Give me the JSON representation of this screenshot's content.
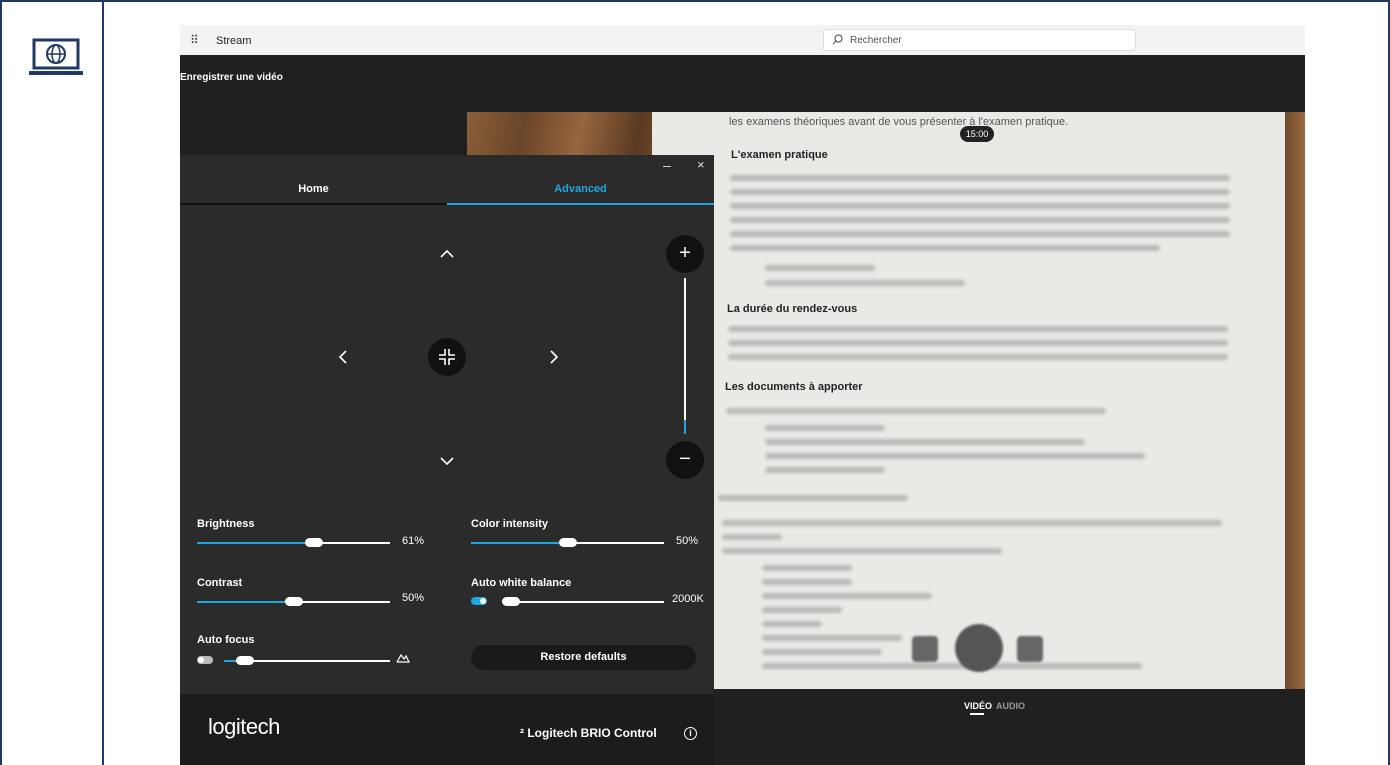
{
  "stream": {
    "app_name": "Stream",
    "search_placeholder": "Rechercher",
    "page_title": "Enregistrer une vidéo"
  },
  "preview": {
    "visible_text": "les examens théoriques avant de vous présenter à l'examen pratique.",
    "headings": [
      "L'examen pratique",
      "La durée du rendez-vous",
      "Les documents à apporter"
    ],
    "timer": "15:00",
    "modes": {
      "video": "VIDÉO",
      "audio": "AUDIO"
    }
  },
  "panel": {
    "window": {
      "minimize": "–",
      "close": "×"
    },
    "tabs": {
      "home": "Home",
      "advanced": "Advanced",
      "active": "Advanced"
    },
    "zoom": {
      "plus": "+",
      "minus": "−",
      "level": 0.09
    },
    "sliders": {
      "brightness": {
        "label": "Brightness",
        "value": "61%",
        "fraction": 0.61
      },
      "color_intensity": {
        "label": "Color intensity",
        "value": "50%",
        "fraction": 0.5
      },
      "contrast": {
        "label": "Contrast",
        "value": "50%",
        "fraction": 0.5
      },
      "auto_white_balance": {
        "label": "Auto white balance",
        "value": "2000K",
        "fraction": 0.0,
        "toggle_on": true
      },
      "auto_focus": {
        "label": "Auto focus",
        "fraction": 0.0,
        "toggle_on": false
      }
    },
    "restore_label": "Restore defaults",
    "footer": {
      "logo": "logitech",
      "product": "² Logitech BRIO Control"
    },
    "accent_color": "#1ea7e1"
  }
}
